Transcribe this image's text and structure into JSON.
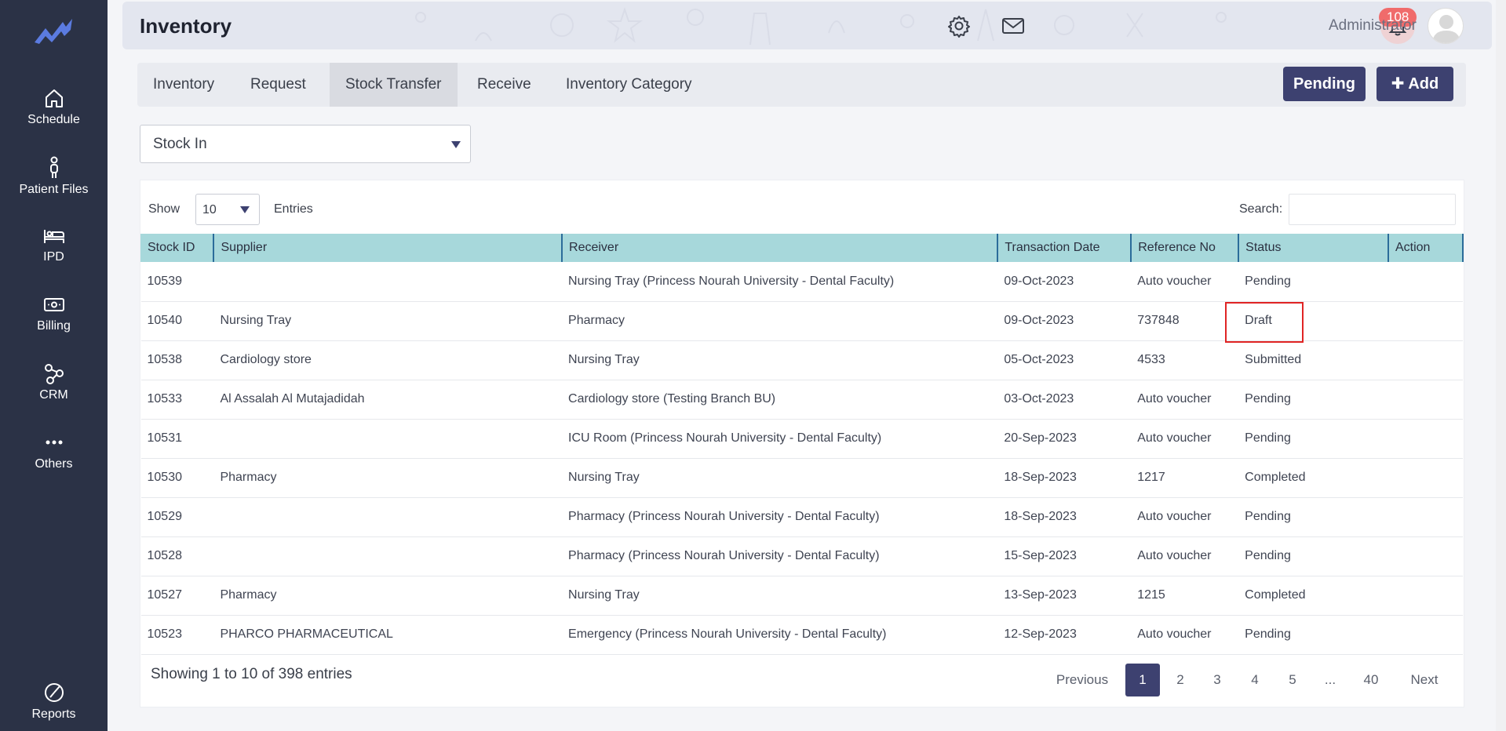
{
  "sidebar": {
    "items": [
      {
        "label": "Schedule",
        "icon": "home-icon"
      },
      {
        "label": "Patient Files",
        "icon": "person-icon"
      },
      {
        "label": "IPD",
        "icon": "bed-icon"
      },
      {
        "label": "Billing",
        "icon": "money-icon"
      },
      {
        "label": "CRM",
        "icon": "network-icon"
      },
      {
        "label": "Others",
        "icon": "dots-icon"
      },
      {
        "label": "Reports",
        "icon": "pie-chart-icon"
      }
    ]
  },
  "header": {
    "title": "Inventory",
    "notification_count": "108",
    "user_name": "Administrator"
  },
  "tabs": [
    {
      "label": "Inventory"
    },
    {
      "label": "Request"
    },
    {
      "label": "Stock Transfer"
    },
    {
      "label": "Receive"
    },
    {
      "label": "Inventory Category"
    }
  ],
  "buttons": {
    "pending": "Pending",
    "add": "✚ Add"
  },
  "filter": {
    "selected": "Stock In"
  },
  "table_controls": {
    "show_label": "Show",
    "entries_value": "10",
    "entries_label": "Entries",
    "search_label": "Search:"
  },
  "table": {
    "columns": [
      "Stock ID",
      "Supplier",
      "Receiver",
      "Transaction Date",
      "Reference No",
      "Status",
      "Action"
    ],
    "rows": [
      [
        "10539",
        "",
        "Nursing Tray (Princess Nourah University - Dental Faculty)",
        "09-Oct-2023",
        "Auto voucher",
        "Pending",
        ""
      ],
      [
        "10540",
        "Nursing Tray",
        "Pharmacy",
        "09-Oct-2023",
        "737848",
        "Draft",
        ""
      ],
      [
        "10538",
        "Cardiology store",
        "Nursing Tray",
        "05-Oct-2023",
        "4533",
        "Submitted",
        ""
      ],
      [
        "10533",
        "Al Assalah Al Mutajadidah",
        "Cardiology store (Testing Branch BU)",
        "03-Oct-2023",
        "Auto voucher",
        "Pending",
        ""
      ],
      [
        "10531",
        "",
        "ICU Room (Princess Nourah University - Dental Faculty)",
        "20-Sep-2023",
        "Auto voucher",
        "Pending",
        ""
      ],
      [
        "10530",
        "Pharmacy",
        "Nursing Tray",
        "18-Sep-2023",
        "1217",
        "Completed",
        ""
      ],
      [
        "10529",
        "",
        "Pharmacy (Princess Nourah University - Dental Faculty)",
        "18-Sep-2023",
        "Auto voucher",
        "Pending",
        ""
      ],
      [
        "10528",
        "",
        "Pharmacy (Princess Nourah University - Dental Faculty)",
        "15-Sep-2023",
        "Auto voucher",
        "Pending",
        ""
      ],
      [
        "10527",
        "Pharmacy",
        "Nursing Tray",
        "13-Sep-2023",
        "1215",
        "Completed",
        ""
      ],
      [
        "10523",
        "PHARCO PHARMACEUTICAL",
        "Emergency (Princess Nourah University - Dental Faculty)",
        "12-Sep-2023",
        "Auto voucher",
        "Pending",
        ""
      ]
    ]
  },
  "footer": {
    "showing": "Showing 1 to 10 of 398 entries",
    "pagination": [
      "Previous",
      "1",
      "2",
      "3",
      "4",
      "5",
      "...",
      "40",
      "Next"
    ],
    "active_page": "1"
  },
  "colors": {
    "sidebar": "#2b3246",
    "accent": "#3d4170",
    "table_header": "#a7d8db",
    "badge": "#f06b6b",
    "highlight": "#e02424"
  }
}
